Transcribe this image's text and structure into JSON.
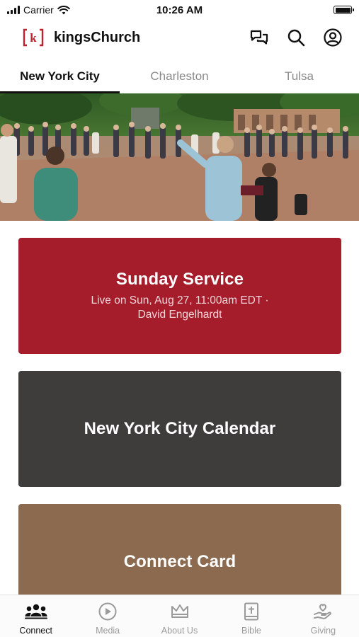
{
  "status_bar": {
    "carrier": "Carrier",
    "time": "10:26 AM",
    "battery_level": 1.0
  },
  "header": {
    "logo_letter": "k",
    "title": "kingsChurch",
    "icons": [
      "chat-icon",
      "search-icon",
      "account-icon"
    ]
  },
  "tabs": [
    {
      "label": "New York City",
      "active": true
    },
    {
      "label": "Charleston",
      "active": false
    },
    {
      "label": "Tulsa",
      "active": false
    }
  ],
  "hero": {
    "icon": "worship-crowd-photo"
  },
  "cards": {
    "service": {
      "title": "Sunday Service",
      "subtitle_line1": "Live on Sun, Aug 27, 11:00am EDT ·",
      "subtitle_line2": "David Engelhardt"
    },
    "calendar": {
      "title": "New York City Calendar"
    },
    "connect": {
      "title": "Connect Card"
    }
  },
  "bottom_nav": [
    {
      "label": "Connect",
      "icon": "people-icon",
      "active": true
    },
    {
      "label": "Media",
      "icon": "play-icon",
      "active": false
    },
    {
      "label": "About Us",
      "icon": "crown-icon",
      "active": false
    },
    {
      "label": "Bible",
      "icon": "bible-icon",
      "active": false
    },
    {
      "label": "Giving",
      "icon": "giving-hand-icon",
      "active": false
    }
  ],
  "colors": {
    "brand_red": "#a51c2b",
    "calendar_gray": "#3e3d3c",
    "connect_brown": "#8b6a4f",
    "active_text": "#111111",
    "inactive_text": "#8a8a8a"
  }
}
